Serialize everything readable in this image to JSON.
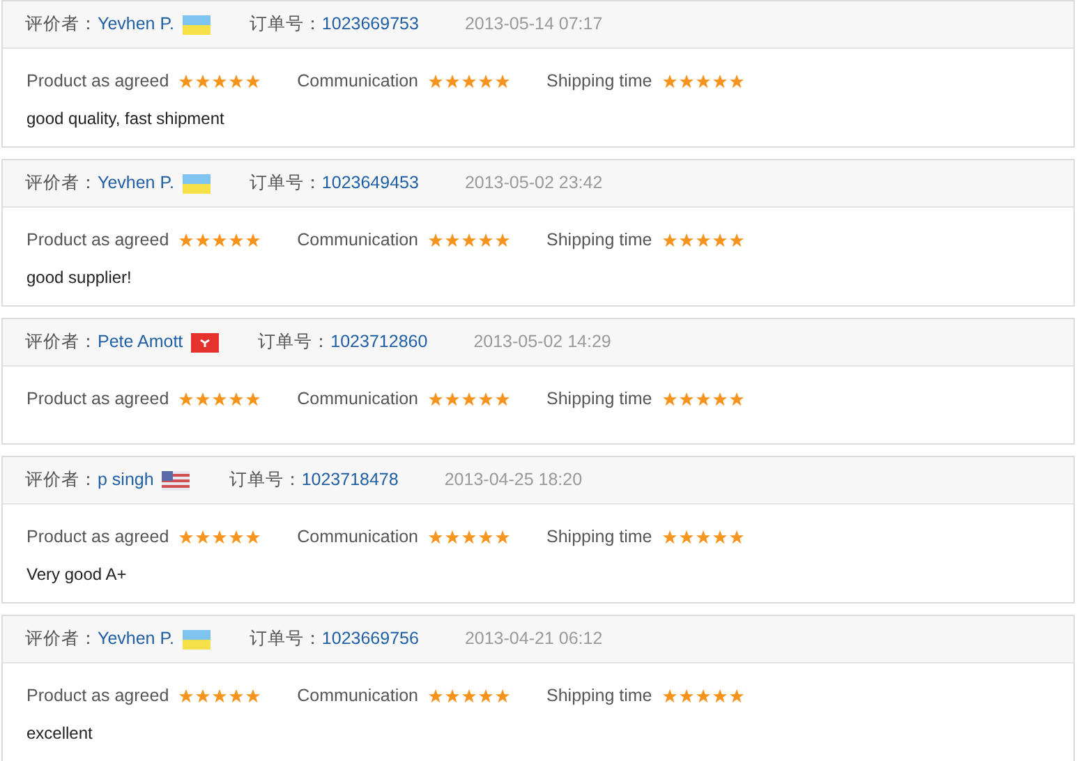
{
  "reviews": [
    {
      "reviewer_label": "评价者：",
      "reviewer": "Yevhen P.",
      "flag": {
        "kind": "ua"
      },
      "order_label": "订单号：",
      "order": "1023669753",
      "date": "2013-05-14 07:17",
      "ratings": [
        {
          "label": "Product as agreed",
          "stars": 5
        },
        {
          "label": "Communication",
          "stars": 5
        },
        {
          "label": "Shipping time",
          "stars": 5
        }
      ],
      "comment": "good quality, fast shipment"
    },
    {
      "reviewer_label": "评价者：",
      "reviewer": "Yevhen P.",
      "flag": {
        "kind": "ua"
      },
      "order_label": "订单号：",
      "order": "1023649453",
      "date": "2013-05-02 23:42",
      "ratings": [
        {
          "label": "Product as agreed",
          "stars": 5
        },
        {
          "label": "Communication",
          "stars": 5
        },
        {
          "label": "Shipping time",
          "stars": 5
        }
      ],
      "comment": "good supplier!"
    },
    {
      "reviewer_label": "评价者：",
      "reviewer": "Pete Amott",
      "flag": {
        "kind": "im"
      },
      "order_label": "订单号：",
      "order": "1023712860",
      "date": "2013-05-02 14:29",
      "ratings": [
        {
          "label": "Product as agreed",
          "stars": 5
        },
        {
          "label": "Communication",
          "stars": 5
        },
        {
          "label": "Shipping time",
          "stars": 5
        }
      ]
    },
    {
      "reviewer_label": "评价者：",
      "reviewer": "p singh",
      "flag": {
        "kind": "us"
      },
      "order_label": "订单号：",
      "order": "1023718478",
      "date": "2013-04-25 18:20",
      "ratings": [
        {
          "label": "Product as agreed",
          "stars": 5
        },
        {
          "label": "Communication",
          "stars": 5
        },
        {
          "label": "Shipping time",
          "stars": 5
        }
      ],
      "comment": "Very good A+"
    },
    {
      "reviewer_label": "评价者：",
      "reviewer": "Yevhen P.",
      "flag": {
        "kind": "ua"
      },
      "order_label": "订单号：",
      "order": "1023669756",
      "date": "2013-04-21 06:12",
      "ratings": [
        {
          "label": "Product as agreed",
          "stars": 5
        },
        {
          "label": "Communication",
          "stars": 5
        },
        {
          "label": "Shipping time",
          "stars": 5
        }
      ],
      "comment": "excellent"
    }
  ]
}
